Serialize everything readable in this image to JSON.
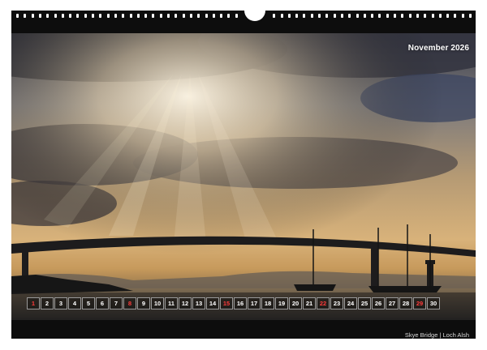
{
  "month_title": "November 2026",
  "caption": "Skye Bridge | Loch Alsh",
  "days": [
    {
      "n": "1",
      "red": true
    },
    {
      "n": "2",
      "red": false
    },
    {
      "n": "3",
      "red": false
    },
    {
      "n": "4",
      "red": false
    },
    {
      "n": "5",
      "red": false
    },
    {
      "n": "6",
      "red": false
    },
    {
      "n": "7",
      "red": false
    },
    {
      "n": "8",
      "red": true
    },
    {
      "n": "9",
      "red": false
    },
    {
      "n": "10",
      "red": false
    },
    {
      "n": "11",
      "red": false
    },
    {
      "n": "12",
      "red": false
    },
    {
      "n": "13",
      "red": false
    },
    {
      "n": "14",
      "red": false
    },
    {
      "n": "15",
      "red": true
    },
    {
      "n": "16",
      "red": false
    },
    {
      "n": "17",
      "red": false
    },
    {
      "n": "18",
      "red": false
    },
    {
      "n": "19",
      "red": false
    },
    {
      "n": "20",
      "red": false
    },
    {
      "n": "21",
      "red": false
    },
    {
      "n": "22",
      "red": true
    },
    {
      "n": "23",
      "red": false
    },
    {
      "n": "24",
      "red": false
    },
    {
      "n": "25",
      "red": false
    },
    {
      "n": "26",
      "red": false
    },
    {
      "n": "27",
      "red": false
    },
    {
      "n": "28",
      "red": false
    },
    {
      "n": "29",
      "red": true
    },
    {
      "n": "30",
      "red": false
    }
  ],
  "colors": {
    "holiday": "#ff3b3b",
    "text": "#ffffff"
  }
}
